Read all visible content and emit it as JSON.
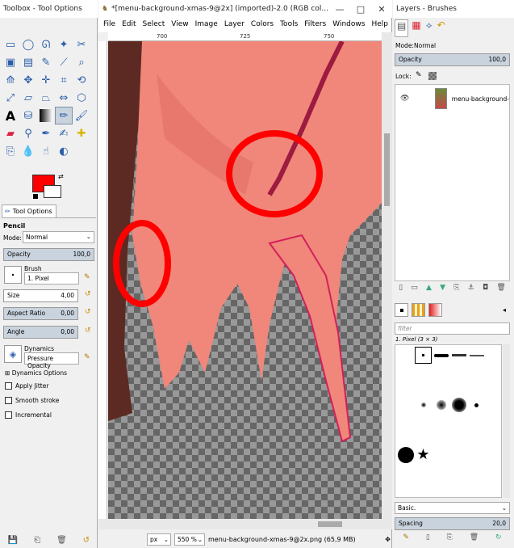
{
  "toolbox": {
    "title": "Toolbox - Tool Options",
    "window_controls": [
      "—",
      "□",
      "✕"
    ],
    "tool_options_tab": "Tool Options",
    "tool_name": "Pencil",
    "mode_label": "Mode:",
    "mode_value": "Normal",
    "opacity_label": "Opacity",
    "opacity_value": "100,0",
    "brush_label": "Brush",
    "brush_value": "1. Pixel",
    "size_label": "Size",
    "size_value": "4,00",
    "aspect_label": "Aspect Ratio",
    "aspect_value": "0,00",
    "angle_label": "Angle",
    "angle_value": "0,00",
    "dynamics_label": "Dynamics",
    "dynamics_value": "Pressure Opacity",
    "dynamics_options": "Dynamics Options",
    "apply_jitter": "Apply Jitter",
    "smooth_stroke": "Smooth stroke",
    "incremental": "Incremental",
    "fg_color": "#ff0000"
  },
  "image_window": {
    "title": "*[menu-background-xmas-9@2x] (imported)-2.0 (RGB col...",
    "menus": [
      "File",
      "Edit",
      "Select",
      "View",
      "Image",
      "Layer",
      "Colors",
      "Tools",
      "Filters",
      "Windows",
      "Help"
    ],
    "ruler_labels": [
      "700",
      "725",
      "750"
    ],
    "unit": "px",
    "zoom": "550 %",
    "status": "menu-background-xmas-9@2x.png (65,9 MB)"
  },
  "layers": {
    "title": "Layers - Brushes",
    "mode_label": "Mode:",
    "mode_value": "Normal",
    "opacity_label": "Opacity",
    "opacity_value": "100,0",
    "lock_label": "Lock:",
    "layer_name": "menu-background-",
    "filter_placeholder": "filter",
    "brush_name": "1. Pixel (3 × 3)",
    "brush_set": "Basic.",
    "spacing_label": "Spacing",
    "spacing_value": "20,0"
  },
  "colors": {
    "accent": "#c9d3de",
    "annotation": "#ff0000",
    "skin": "#f0877a"
  }
}
